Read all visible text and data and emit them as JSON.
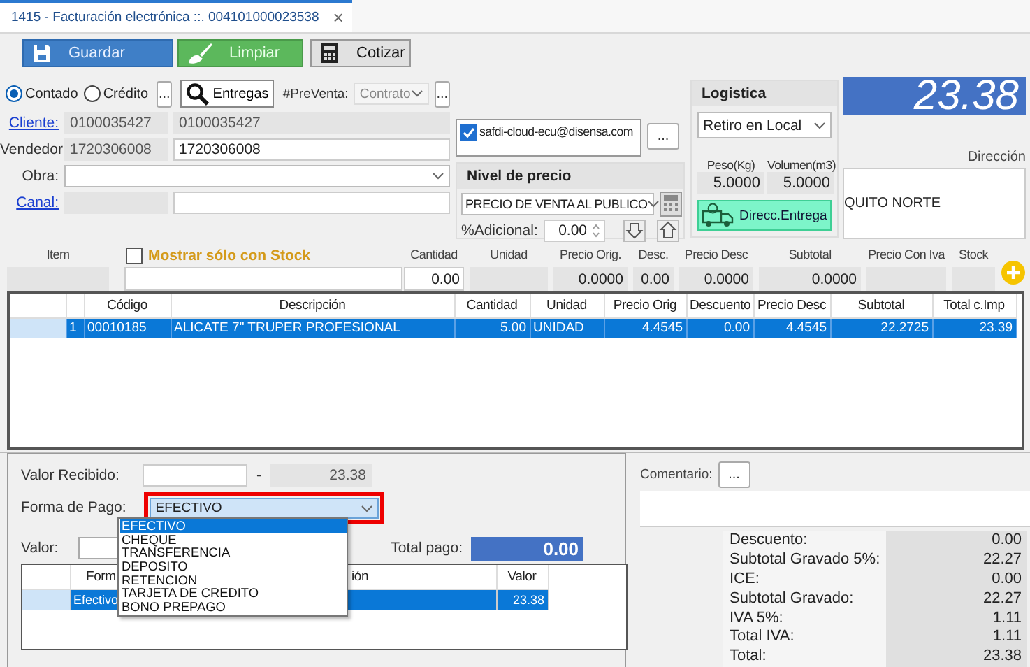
{
  "tab": {
    "title": "1415 - Facturación electrónica ::. 004101000023538",
    "close": "×"
  },
  "toolbar": [
    {
      "kind": "save",
      "label": "Guardar"
    },
    {
      "kind": "clear",
      "label": "Limpiar"
    },
    {
      "kind": "quote",
      "label": "Cotizar"
    }
  ],
  "payment_type": [
    {
      "label": "Contado",
      "selected": true
    },
    {
      "label": "Crédito",
      "selected": false
    }
  ],
  "payment_type_more": "...",
  "deliveries_button": "Entregas",
  "presale": {
    "label": "#PreVenta:",
    "value": "Contrato",
    "disabled": true,
    "more": "..."
  },
  "customer": {
    "label": "Cliente:",
    "code": "0100035427",
    "name": "0100035427"
  },
  "seller": {
    "label": "Vendedor:",
    "code": "1720306008",
    "name": "1720306008"
  },
  "project": {
    "label": "Obra:"
  },
  "channel": {
    "label": "Canal:"
  },
  "email": {
    "text": "safdi-cloud-ecu@disensa.com",
    "checked": true,
    "more": "..."
  },
  "price_level": {
    "title": "Nivel de precio",
    "value": "PRECIO DE VENTA AL PUBLICO",
    "additional_label": "%Adicional:",
    "additional": "0.00"
  },
  "logistics": {
    "title": "Logistica",
    "mode": "Retiro en Local",
    "weight_label": "Peso(Kg)",
    "weight": "5.0000",
    "volume_label": "Volumen(m3)",
    "volume": "5.0000",
    "delivery_button": "Direcc.Entrega"
  },
  "total": "23.38",
  "address": {
    "label": "Dirección",
    "value": "QUITO NORTE"
  },
  "item_entry": {
    "item_label": "Item",
    "stock_filter": {
      "label": "Mostrar sólo con Stock",
      "checked": false
    },
    "fields": [
      {
        "label": "Cantidad",
        "value": "0.00",
        "editable": true
      },
      {
        "label": "Unidad",
        "editable": false
      },
      {
        "label": "Precio Orig.",
        "value": "0.0000",
        "editable": false
      },
      {
        "label": "Desc.",
        "value": "0.00",
        "editable": false
      },
      {
        "label": "Precio Desc",
        "value": "0.0000",
        "editable": false
      },
      {
        "label": "Subtotal",
        "value": "0.0000",
        "editable": false
      },
      {
        "label": "Precio Con Iva",
        "editable": false
      },
      {
        "label": "Stock",
        "editable": false
      }
    ]
  },
  "items_table": {
    "columns": [
      "Código",
      "Descripción",
      "Cantidad",
      "Unidad",
      "Precio Orig",
      "Descuento",
      "Precio Desc",
      "Subtotal",
      "Total c.Imp"
    ],
    "rows": [
      {
        "selected": true,
        "number": "1",
        "cells": [
          "00010185",
          "ALICATE 7\" TRUPER PROFESIONAL",
          "5.00",
          "UNIDAD",
          "4.4545",
          "0.00",
          "4.4545",
          "22.2725",
          "23.39"
        ]
      }
    ]
  },
  "payment": {
    "received_label": "Valor Recibido:",
    "dash": "-",
    "due": "23.38",
    "method_label": "Forma de Pago:",
    "method": "EFECTIVO",
    "options": [
      {
        "label": "EFECTIVO",
        "selected": true
      },
      {
        "label": "CHEQUE",
        "selected": false
      },
      {
        "label": "TRANSFERENCIA",
        "selected": false
      },
      {
        "label": "DEPOSITO",
        "selected": false
      },
      {
        "label": "RETENCION",
        "selected": false
      },
      {
        "label": "TARJETA DE CREDITO",
        "selected": false
      },
      {
        "label": "BONO PREPAGO",
        "selected": false
      }
    ],
    "amount_label": "Valor:",
    "total_label": "Total pago:",
    "total": "0.00",
    "table": {
      "columns": [
        "Form",
        "ión",
        "Valor"
      ],
      "rows": [
        {
          "selected": true,
          "cells": [
            "Efectivo",
            "",
            "23.38"
          ]
        }
      ]
    }
  },
  "comment": {
    "label": "Comentario:",
    "button": "..."
  },
  "summary": [
    {
      "label": "Descuento:",
      "value": "0.00"
    },
    {
      "label": "Subtotal Gravado 5%:",
      "value": "22.27"
    },
    {
      "label": "ICE:",
      "value": "0.00"
    },
    {
      "label": "Subtotal Gravado:",
      "value": "22.27"
    },
    {
      "label": "IVA 5%:",
      "value": "1.11"
    },
    {
      "label": "Total IVA:",
      "value": "1.11"
    },
    {
      "label": "Total:",
      "value": "23.38"
    }
  ]
}
